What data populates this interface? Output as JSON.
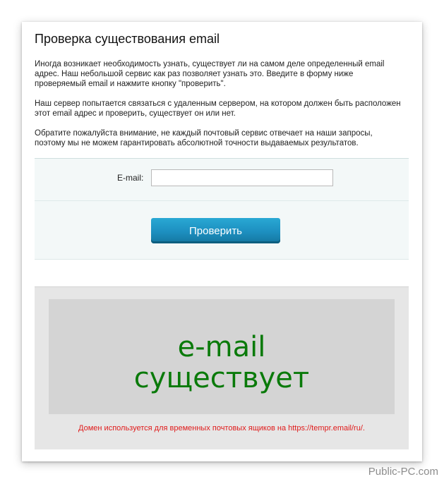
{
  "page": {
    "title": "Проверка существования email",
    "intro": [
      "Иногда возникает необходимость узнать, существует ли на самом деле определенный email адрес. Наш небольшой сервис как раз позволяет узнать это. Введите в форму ниже проверяемый email и нажмите кнопку \"проверить\".",
      "Наш сервер попытается связаться с удаленным сервером, на котором должен быть расположен этот email адрес и проверить, существует он или нет.",
      "Обратите пожалуйста внимание, не каждый почтовый сервис отвечает на наши запросы, поэтому мы не можем гарантировать абсолютной точности выдаваемых результатов."
    ]
  },
  "form": {
    "email_label": "E-mail:",
    "email_value": "",
    "submit_label": "Проверить"
  },
  "result": {
    "line1": "e-mail",
    "line2": "существует",
    "note": "Домен используется для временных почтовых ящиков на https://tempr.email/ru/.",
    "color": "#0a7a0a",
    "note_color": "#e01b1b"
  },
  "watermark": "Public-PC.com"
}
